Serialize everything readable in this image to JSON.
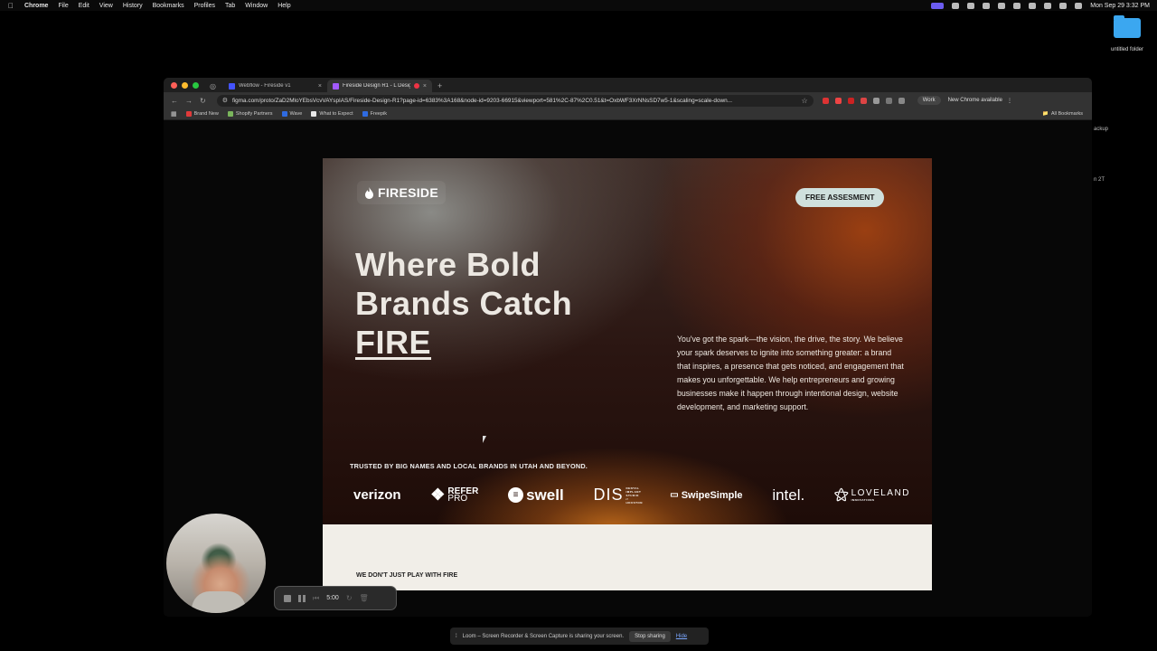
{
  "menubar": {
    "app": "Chrome",
    "items": [
      "File",
      "Edit",
      "View",
      "History",
      "Bookmarks",
      "Profiles",
      "Tab",
      "Window",
      "Help"
    ],
    "clock": "Mon Sep 29  3:32 PM"
  },
  "desktop": {
    "folder_label": "untitled folder",
    "side_label_1": "ackup",
    "side_label_2": "n 2T"
  },
  "browser": {
    "tabs": [
      {
        "title": "Webflow - Fireside v1",
        "favicon_color": "#4353ff"
      },
      {
        "title": "Fireside Design R1 - L Design",
        "favicon_color": "#a259ff"
      }
    ],
    "new_tab": "+",
    "url": "figma.com/proto/ZaD2MloYEbsVcvVAYspIAS/Fireside-Design-R1?page-id=6383%3A168&node-id=9203-66915&viewport=581%2C-87%2C0.51&t=OxbWF3XrNNsSD7w5-1&scaling=scale-down...",
    "profile": "Work",
    "update_chip": "New Chrome available",
    "bookmarks": [
      {
        "label": "Brand New",
        "color": "#e03a3a"
      },
      {
        "label": "Shopify Partners",
        "color": "#7ab55c"
      },
      {
        "label": "Wave",
        "color": "#2f6be0"
      },
      {
        "label": "What to Expect",
        "color": "#e8e8e8"
      },
      {
        "label": "Freepik",
        "color": "#2f6be0"
      }
    ],
    "all_bookmarks": "All Bookmarks"
  },
  "site": {
    "logo": "FIRESIDE",
    "cta": "FREE ASSESMENT",
    "headline_line1": "Where Bold",
    "headline_line2": "Brands Catch",
    "headline_line3": "FIRE",
    "blurb": "You've got the spark—the vision, the drive, the story. We believe your spark deserves to ignite into something greater: a brand that inspires, a presence that gets noticed, and engagement that makes you unforgettable. We help entrepreneurs and growing businesses make it happen through intentional design, website development, and marketing support.",
    "trusted": "TRUSTED BY BIG NAMES AND LOCAL BRANDS IN UTAH AND BEYOND.",
    "brands": {
      "verizon": "verizon",
      "refer_top": "REFER",
      "refer_bottom": "PRO",
      "swell": "swell",
      "dis": "DIS",
      "dis_sub": "DENTAL IMPLANT STUDIO // HOUSTON",
      "swipe": "SwipeSimple",
      "intel": "intel.",
      "loveland": "LOVELAND",
      "loveland_sub": "INNOVATIONS"
    },
    "section2_kicker": "WE DON'T JUST PLAY WITH FIRE"
  },
  "loom": {
    "timer": "5:00",
    "share_text": "Loom – Screen Recorder & Screen Capture is sharing your screen.",
    "stop": "Stop sharing",
    "hide": "Hide"
  },
  "colors": {
    "cta_bg": "#cfe0dd",
    "section2_bg": "#f1eee8",
    "loom_accent": "#5865f2"
  }
}
